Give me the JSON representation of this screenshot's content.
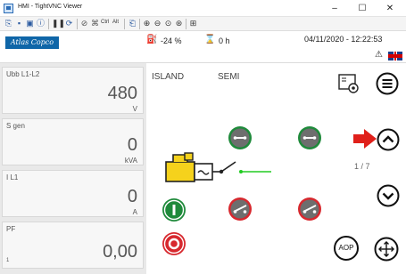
{
  "window": {
    "title": "HMI - TightVNC Viewer",
    "minimize": "–",
    "maximize": "☐",
    "close": "✕"
  },
  "toolbar": {
    "ctrl_label": "Ctrl",
    "alt_label": "Alt"
  },
  "header": {
    "logo": "Atlas Copco",
    "fuel_value": "-24 %",
    "hours_value": "0 h",
    "datetime": "04/11/2020 - 12:22:53"
  },
  "panels": [
    {
      "label": "Ubb L1-L2",
      "value": "480",
      "unit": "V"
    },
    {
      "label": "S gen",
      "value": "0",
      "unit": "kVA"
    },
    {
      "label": "I L1",
      "value": "0",
      "unit": "A"
    },
    {
      "label": "PF",
      "value": "0,00",
      "sub": "1"
    }
  ],
  "main": {
    "mode_island": "ISLAND",
    "mode_semi": "SEMI",
    "page_indicator": "1 / 7",
    "aop_label": "AOP"
  },
  "colors": {
    "green": "#1f8a3b",
    "red": "#d7282e",
    "gray": "#6f6f6f",
    "yellow": "#f5d21c",
    "arrow_red": "#e0201a",
    "line_green": "#22cc22"
  }
}
